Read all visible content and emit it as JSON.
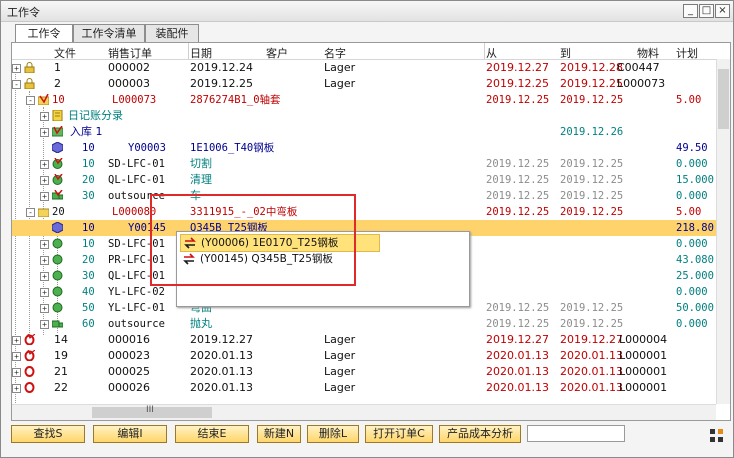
{
  "window": {
    "title": "工作令"
  },
  "tabs": [
    "工作令",
    "工作令清单",
    "装配件"
  ],
  "columns": {
    "file": "文件",
    "sales_order": "销售订单",
    "date": "日期",
    "customer": "客户",
    "name": "名字",
    "from": "从",
    "to": "到",
    "material": "物料",
    "plan": "计划"
  },
  "rows": [
    {
      "c1": "1",
      "c2": "000002",
      "c3": "2019.12.24",
      "c4": "Lager",
      "from": "2019.12.27",
      "to": "2019.12.28",
      "mat": "C00447",
      "plan": ""
    },
    {
      "c1": "2",
      "c2": "000003",
      "c3": "2019.12.25",
      "c4": "Lager",
      "from": "2019.12.25",
      "to": "2019.12.25",
      "mat": "L000073",
      "plan": ""
    },
    {
      "c1": "10",
      "c2": "L000073",
      "c3": "2876274B1_0轴套",
      "c4": "",
      "from": "2019.12.25",
      "to": "2019.12.25",
      "mat": "",
      "plan": "5.00"
    },
    {
      "c1": "",
      "c2": "",
      "c3": "",
      "c4": "",
      "from": "",
      "to": "",
      "mat": "",
      "plan": "",
      "label": "日记账分录"
    },
    {
      "c1": "",
      "c2": "",
      "c3": "",
      "c4": "",
      "from": "",
      "to": "2019.12.26",
      "mat": "",
      "plan": "",
      "label": "入库 1"
    },
    {
      "c1": "10",
      "c2": "Y00003",
      "c3": "1E1006_T40钢板",
      "c4": "",
      "from": "",
      "to": "",
      "mat": "",
      "plan": "49.50"
    },
    {
      "c1": "10",
      "c2": "SD-LFC-01",
      "c3": "切割",
      "c4": "",
      "from": "2019.12.25",
      "to": "2019.12.25",
      "mat": "",
      "plan": "0.000"
    },
    {
      "c1": "20",
      "c2": "QL-LFC-01",
      "c3": "清理",
      "c4": "",
      "from": "2019.12.25",
      "to": "2019.12.25",
      "mat": "",
      "plan": "15.000"
    },
    {
      "c1": "30",
      "c2": "outsource",
      "c3": "车",
      "c4": "",
      "from": "2019.12.25",
      "to": "2019.12.25",
      "mat": "",
      "plan": "0.000"
    },
    {
      "c1": "20",
      "c2": "L000080",
      "c3": "3311915_-_02中弯板",
      "c4": "",
      "from": "2019.12.25",
      "to": "2019.12.25",
      "mat": "",
      "plan": "5.00"
    },
    {
      "c1": "10",
      "c2": "Y00145",
      "c3": "Q345B_T25钢板",
      "c4": "",
      "from": "",
      "to": "",
      "mat": "",
      "plan": "218.80"
    },
    {
      "c1": "10",
      "c2": "SD-LFC-01",
      "c3": "",
      "c4": "",
      "from": "",
      "to": "",
      "mat": "",
      "plan": "0.000"
    },
    {
      "c1": "20",
      "c2": "PR-LFC-01",
      "c3": "",
      "c4": "",
      "from": "",
      "to": "",
      "mat": "",
      "plan": "43.080"
    },
    {
      "c1": "30",
      "c2": "QL-LFC-01",
      "c3": "",
      "c4": "",
      "from": "",
      "to": "",
      "mat": "",
      "plan": "25.000"
    },
    {
      "c1": "40",
      "c2": "YL-LFC-02",
      "c3": "",
      "c4": "",
      "from": "",
      "to": "",
      "mat": "",
      "plan": "0.000"
    },
    {
      "c1": "50",
      "c2": "YL-LFC-01",
      "c3": "弯曲",
      "c4": "",
      "from": "2019.12.25",
      "to": "2019.12.25",
      "mat": "",
      "plan": "50.000"
    },
    {
      "c1": "60",
      "c2": "outsource",
      "c3": "抛丸",
      "c4": "",
      "from": "2019.12.25",
      "to": "2019.12.25",
      "mat": "",
      "plan": "0.000"
    },
    {
      "c1": "14",
      "c2": "000016",
      "c3": "2019.12.27",
      "c4": "Lager",
      "from": "2019.12.27",
      "to": "2019.12.27",
      "mat": "L000004",
      "plan": ""
    },
    {
      "c1": "19",
      "c2": "000023",
      "c3": "2020.01.13",
      "c4": "Lager",
      "from": "2020.01.13",
      "to": "2020.01.13",
      "mat": "L000001",
      "plan": ""
    },
    {
      "c1": "21",
      "c2": "000025",
      "c3": "2020.01.13",
      "c4": "Lager",
      "from": "2020.01.13",
      "to": "2020.01.13",
      "mat": "L000001",
      "plan": ""
    },
    {
      "c1": "22",
      "c2": "000026",
      "c3": "2020.01.13",
      "c4": "Lager",
      "from": "2020.01.13",
      "to": "2020.01.13",
      "mat": "L000001",
      "plan": ""
    }
  ],
  "popup": {
    "items": [
      "(Y00006) 1E0170_T25钢板",
      "(Y00145) Q345B_T25钢板"
    ]
  },
  "buttons": [
    "查找S",
    "编辑I",
    "结束E",
    "新建N",
    "删除L",
    "打开订单C",
    "产品成本分析"
  ],
  "scroll_h_label": "III",
  "colors": {
    "red": "#c00000",
    "teal": "#008080",
    "blue": "#000090",
    "gray": "#8c8c8c",
    "green": "#007000",
    "highlight": "#ffd36b"
  }
}
